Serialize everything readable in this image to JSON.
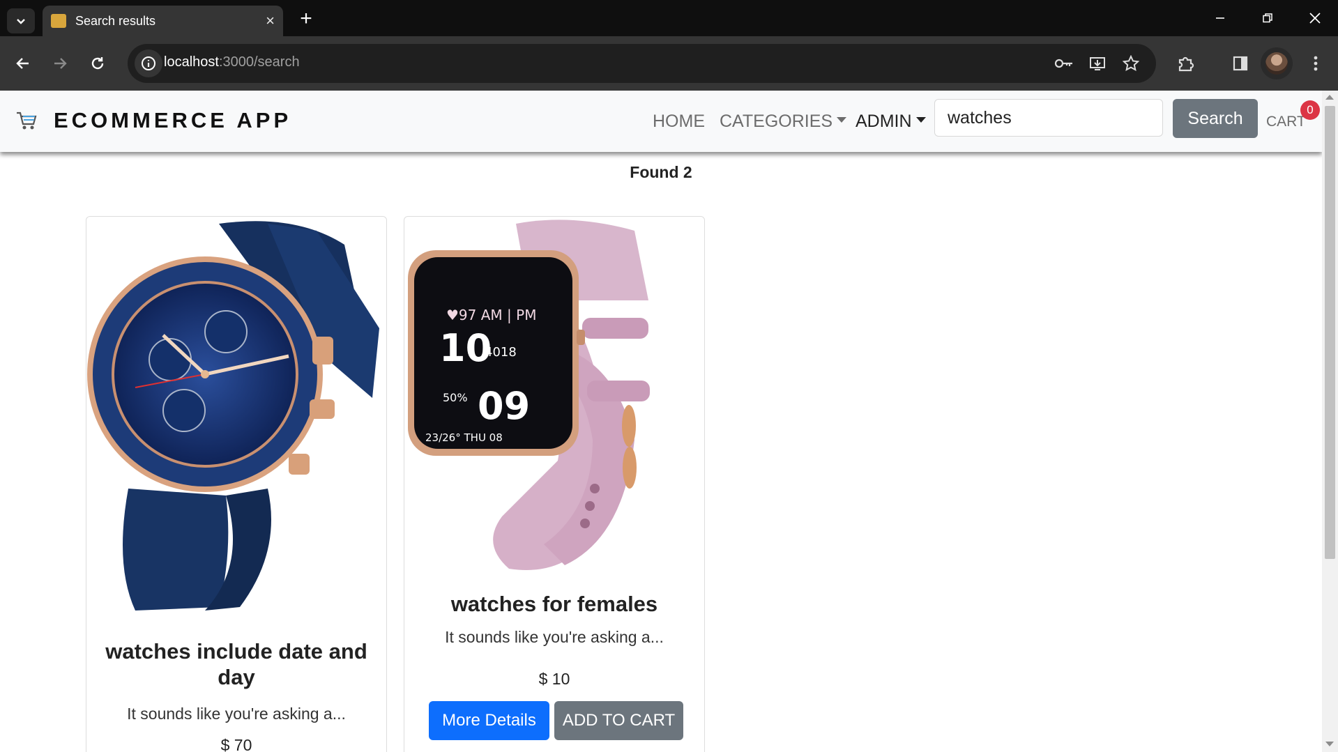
{
  "browser": {
    "tab_title": "Search results",
    "url_host": "localhost",
    "url_rest": ":3000/search"
  },
  "navbar": {
    "brand": "ECOMMERCE APP",
    "home": "HOME",
    "categories": "CATEGORIES",
    "admin": "ADMIN",
    "search_value": "watches",
    "search_button": "Search",
    "cart": "CART",
    "cart_count": "0"
  },
  "results": {
    "summary": "Found 2",
    "products": [
      {
        "title": "watches include date and day",
        "description": "It sounds like you're asking a...",
        "price": "$ 70"
      },
      {
        "title": "watches for females",
        "description": "It sounds like you're asking a...",
        "price": "$ 10",
        "details_button": "More Details",
        "cart_button": "ADD TO CART"
      }
    ]
  },
  "colors": {
    "primary": "#0d6efd",
    "secondary": "#6c757d",
    "badge": "#dc3545"
  }
}
